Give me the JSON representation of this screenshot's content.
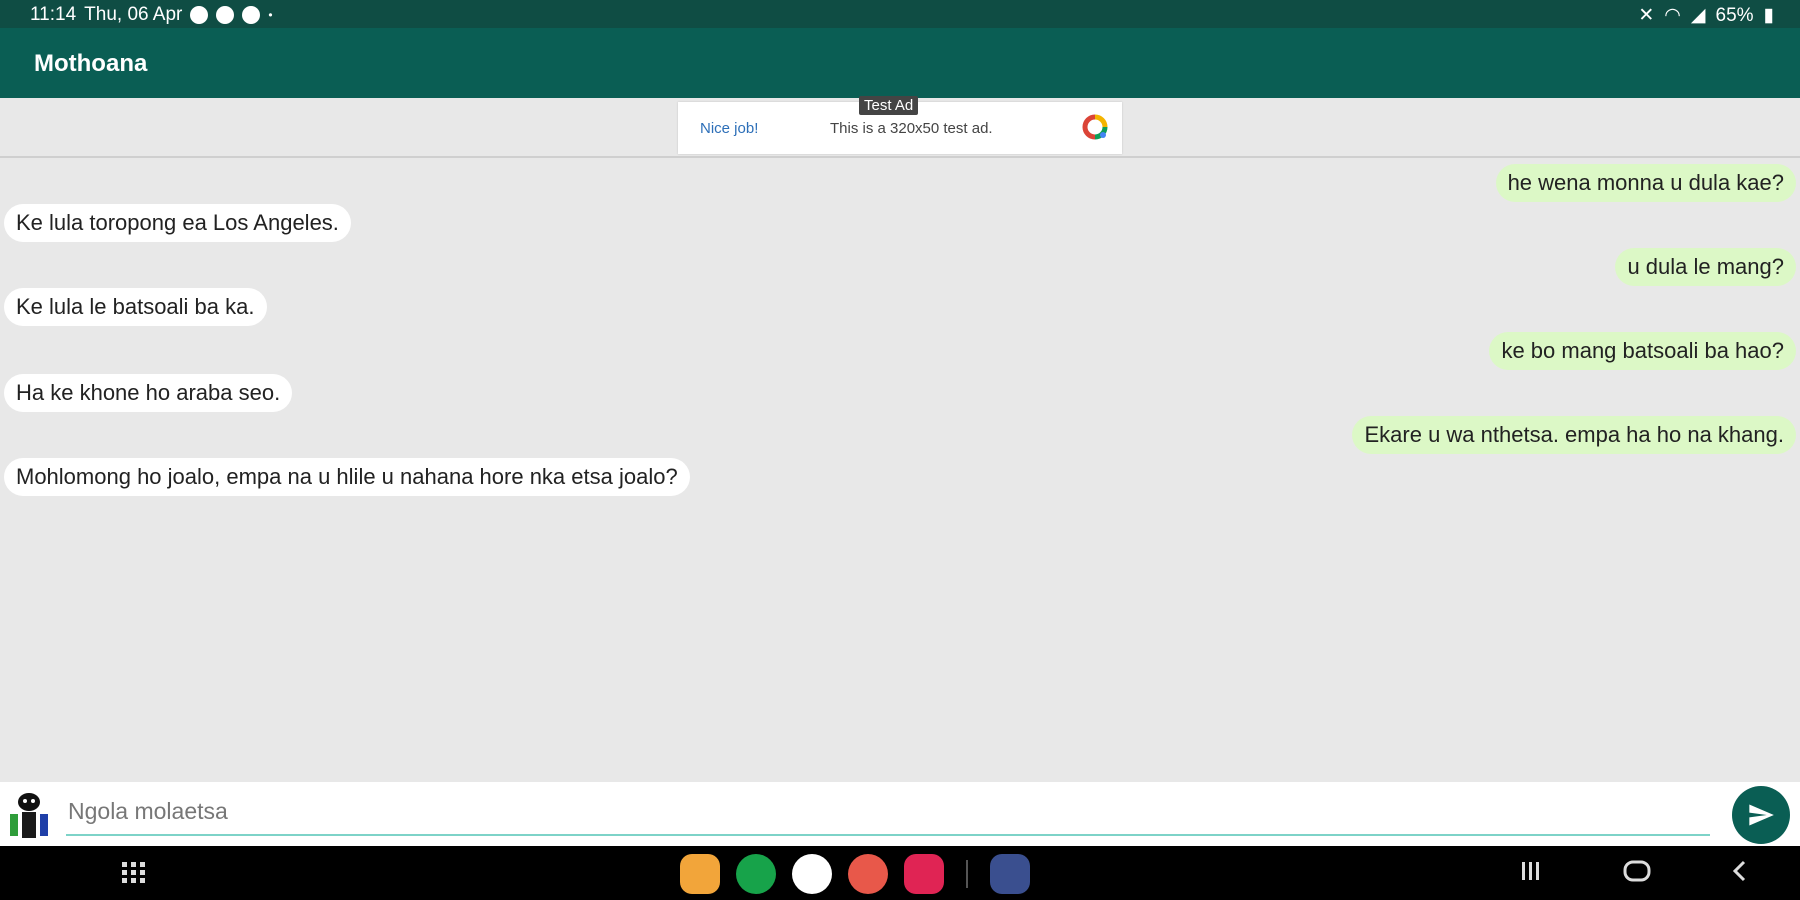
{
  "status": {
    "time": "11:14",
    "date": "Thu, 06 Apr",
    "battery": "65%"
  },
  "app": {
    "title": "Mothoana"
  },
  "ad": {
    "tag": "Test Ad",
    "headline": "Nice job!",
    "description": "This is a 320x50 test ad."
  },
  "messages": [
    {
      "side": "out",
      "text": "he wena monna u dula kae?"
    },
    {
      "side": "in",
      "text": "Ke lula toropong ea Los Angeles."
    },
    {
      "side": "out",
      "text": "u dula le mang?"
    },
    {
      "side": "in",
      "text": "Ke lula le batsoali ba ka."
    },
    {
      "side": "out",
      "text": "ke bo mang batsoali ba hao?"
    },
    {
      "side": "in",
      "text": "Ha ke khone ho araba seo."
    },
    {
      "side": "out",
      "text": "Ekare u wa nthetsa. empa ha ho na khang."
    },
    {
      "side": "in",
      "text": "Mohlomong ho joalo, empa na u hlile u nahana hore nka etsa joalo?"
    }
  ],
  "composer": {
    "placeholder": "Ngola molaetsa"
  },
  "icons": {
    "send": "send-icon",
    "avatar": "robot-avatar-icon"
  },
  "colors": {
    "statusbar": "#0f4d44",
    "appbar": "#0a5e54",
    "incoming": "#ffffff",
    "outgoing": "#dcf8c6",
    "background": "#e8e8e8"
  }
}
